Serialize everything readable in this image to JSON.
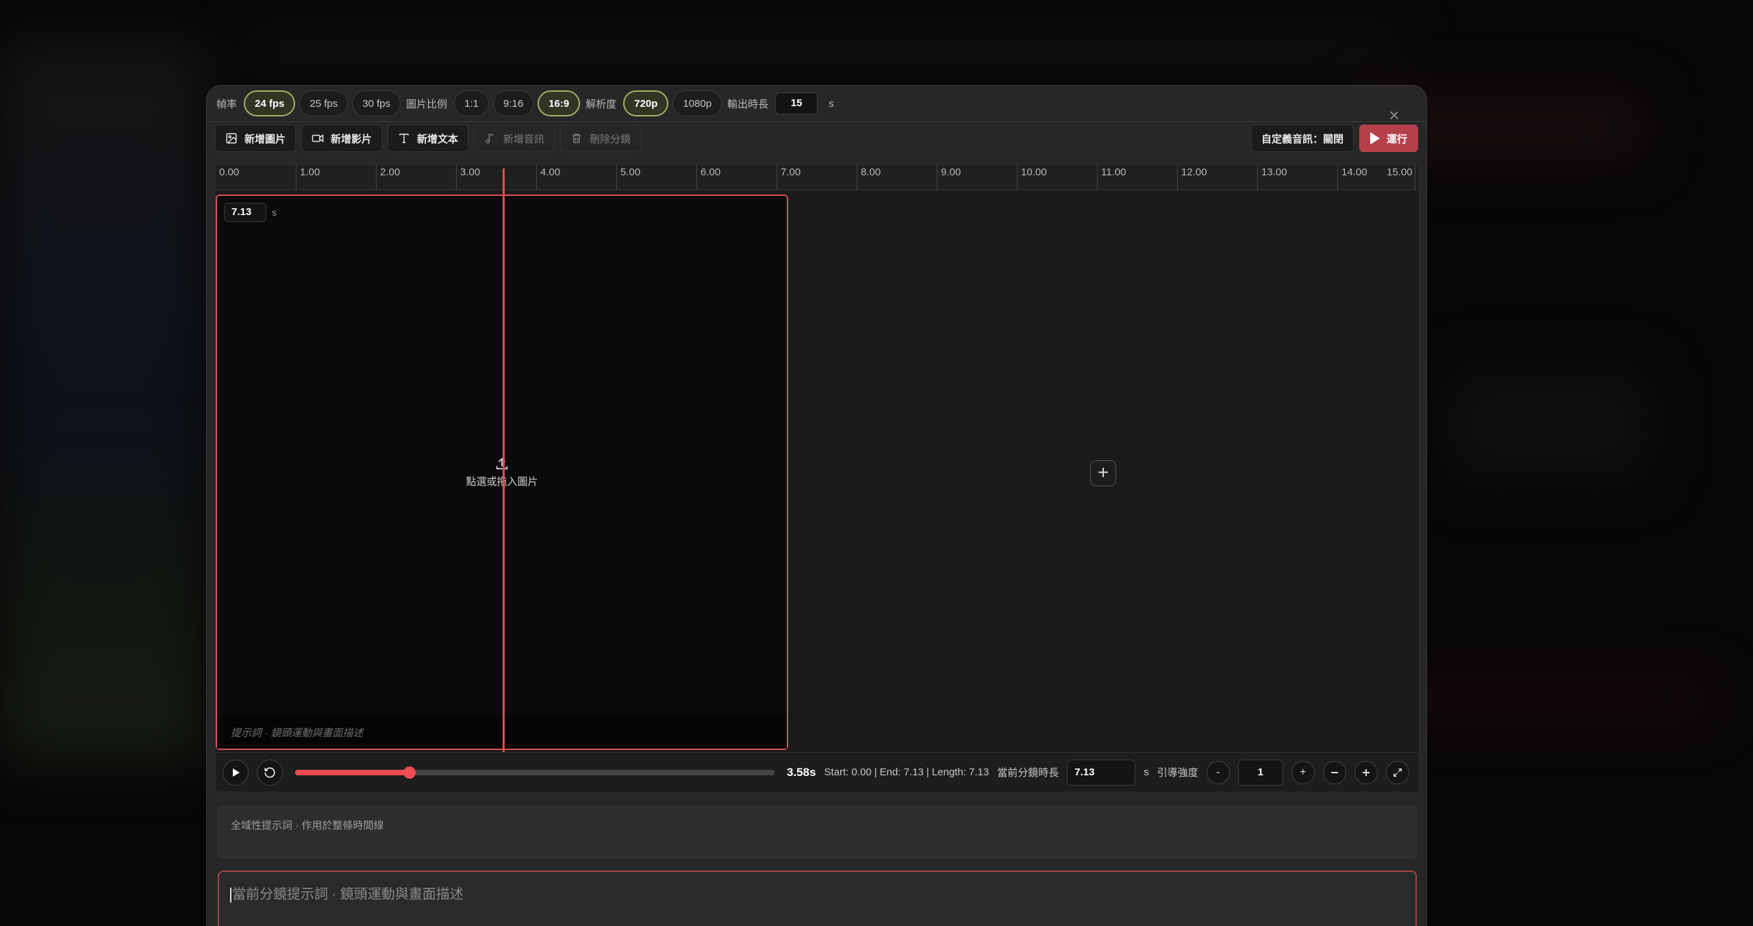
{
  "settings": {
    "fps_label": "幀率",
    "fps_options": [
      "24 fps",
      "25 fps",
      "30 fps"
    ],
    "fps_selected": "24 fps",
    "ratio_label": "圖片比例",
    "ratio_options": [
      "1:1",
      "9:16",
      "16:9"
    ],
    "ratio_selected": "16:9",
    "res_label": "解析度",
    "res_options": [
      "720p",
      "1080p"
    ],
    "res_selected": "720p",
    "duration_label": "輸出時長",
    "duration_value": "15",
    "duration_unit": "s",
    "accent_color": "#a2b36a"
  },
  "toolbar": {
    "add_image": "新增圖片",
    "add_video": "新增影片",
    "add_text": "新增文本",
    "add_audio": "新增音訊",
    "delete_shot": "刪除分鏡",
    "custom_audio": "自定義音訊：關閉",
    "run": "運行",
    "run_color": "#b6404a"
  },
  "timeline": {
    "ruler_ticks": [
      "0.00",
      "1.00",
      "2.00",
      "3.00",
      "4.00",
      "5.00",
      "6.00",
      "7.00",
      "8.00",
      "9.00",
      "10.00",
      "11.00",
      "12.00",
      "13.00",
      "14.00",
      "15.00"
    ],
    "clip": {
      "duration": "7.13",
      "unit": "s",
      "upload_hint": "點選或拖入圖片",
      "prompt_placeholder": "提示詞 · 鏡頭運動與畫面描述"
    },
    "playhead_time": 3.58
  },
  "controls": {
    "current_time": "3.58s",
    "progress": 0.2387,
    "start_text": "Start: 0.00",
    "end_text": "End: 7.13",
    "length_text": "Length: 7.13",
    "shot_duration_label": "當前分鏡時長",
    "shot_duration_value": "7.13",
    "shot_duration_unit": "s",
    "guidance_label": "引導強度",
    "guidance_value": "1",
    "minus": "-",
    "plus": "+"
  },
  "prompts": {
    "global_placeholder": "全域性提示詞 · 作用於整條時間線",
    "shot_placeholder": "當前分鏡提示詞 · 鏡頭運動與畫面描述"
  }
}
